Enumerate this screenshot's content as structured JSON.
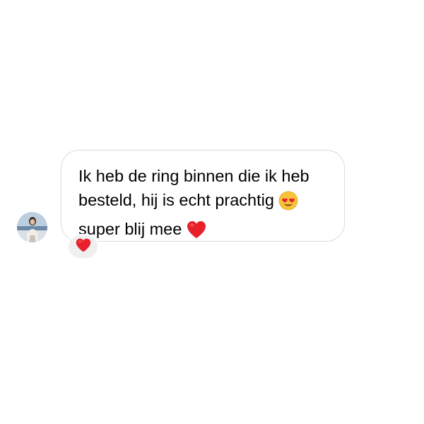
{
  "conversation": {
    "message": {
      "lines": [
        "Ik heb de ring binnen die ik heb",
        "besteld, hij is echt prachtig",
        "super blij mee"
      ],
      "emojis": [
        "heart-eyes-emoji",
        "red-heart-emoji"
      ]
    },
    "reaction": {
      "icon": "red-heart-icon",
      "color": "#e8202a"
    },
    "colors": {
      "bubble_border": "#dbdbdb",
      "reaction_bg": "#efefef",
      "text": "#000000"
    }
  }
}
